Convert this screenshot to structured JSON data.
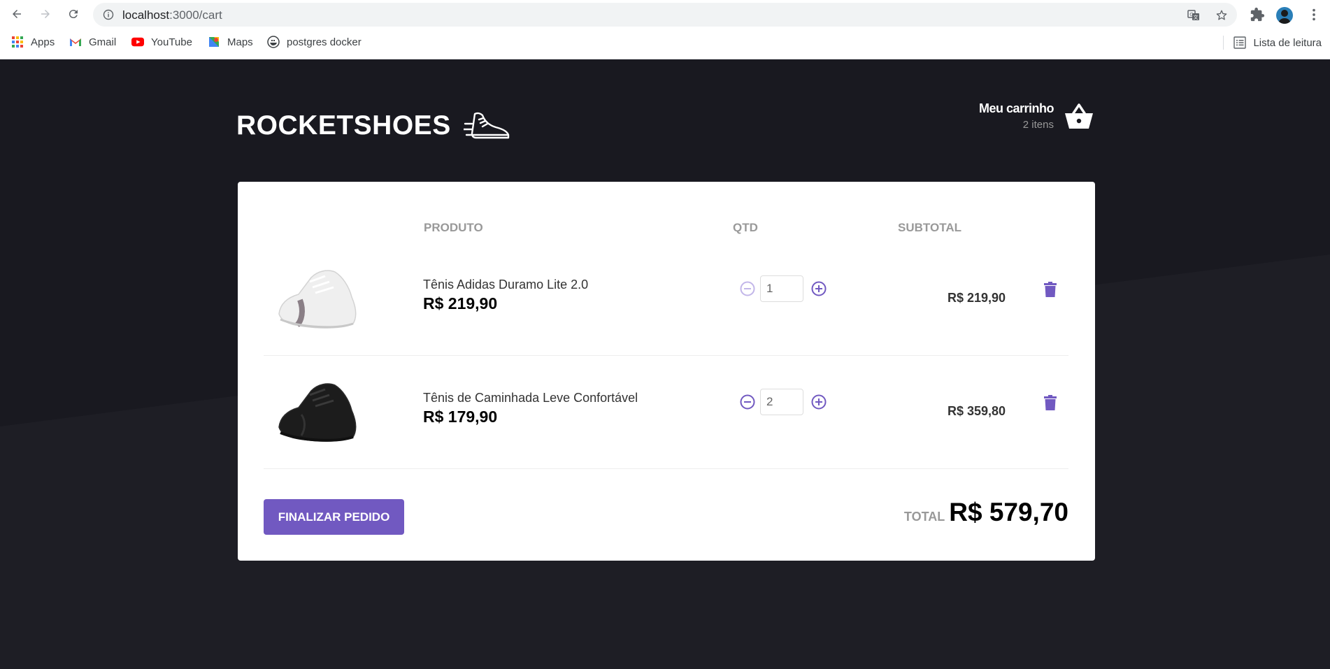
{
  "browser": {
    "url_host": "localhost",
    "url_path": ":3000/cart",
    "bookmarks": [
      {
        "label": "Apps",
        "icon": "apps-grid-icon"
      },
      {
        "label": "Gmail",
        "icon": "gmail-icon"
      },
      {
        "label": "YouTube",
        "icon": "youtube-icon"
      },
      {
        "label": "Maps",
        "icon": "maps-icon"
      },
      {
        "label": "postgres docker",
        "icon": "docker-icon"
      }
    ],
    "reading_list": "Lista de leitura"
  },
  "header": {
    "logo_text": "ROCKETSHOES",
    "cart_title": "Meu carrinho",
    "cart_count": "2 itens"
  },
  "table": {
    "col_product": "PRODUTO",
    "col_qty": "QTD",
    "col_subtotal": "SUBTOTAL",
    "items": [
      {
        "title": "Tênis Adidas Duramo Lite 2.0",
        "price": "R$ 219,90",
        "qty": "1",
        "subtotal": "R$ 219,90",
        "shoe_color": "white",
        "decrement_disabled": true
      },
      {
        "title": "Tênis de Caminhada Leve Confortável",
        "price": "R$ 179,90",
        "qty": "2",
        "subtotal": "R$ 359,80",
        "shoe_color": "black",
        "decrement_disabled": false
      }
    ]
  },
  "footer": {
    "checkout_label": "FINALIZAR PEDIDO",
    "total_label": "TOTAL",
    "total_value": "R$ 579,70"
  },
  "colors": {
    "accent": "#7159c1",
    "background": "#191920",
    "panel": "#ffffff"
  }
}
